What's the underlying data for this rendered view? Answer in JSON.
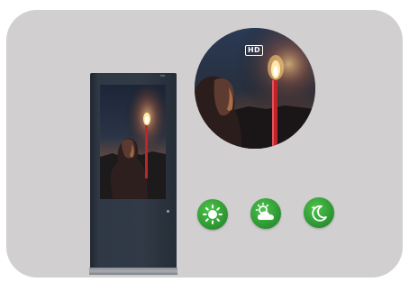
{
  "badge": {
    "hd_label": "HD"
  },
  "modes": [
    {
      "name": "sunny",
      "icon": "sun-icon"
    },
    {
      "name": "cloudy",
      "icon": "partly-cloudy-icon"
    },
    {
      "name": "night",
      "icon": "moon-stars-icon"
    }
  ],
  "colors": {
    "panel_background": "#d1cfd0",
    "kiosk_frame": "#313a46",
    "mode_button_green": "#2f9a34",
    "candle_red": "#c0242b",
    "flame": "#ffd27a"
  }
}
